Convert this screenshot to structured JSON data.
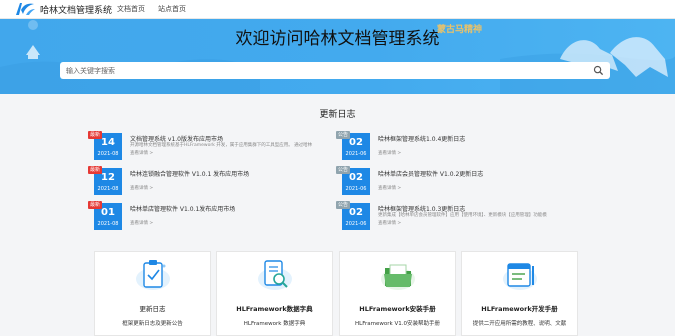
{
  "header": {
    "brand": "哈林文档管理系统",
    "nav": [
      "文档首页",
      "站点首页"
    ]
  },
  "hero": {
    "title": "欢迎访问哈林文档管理系统",
    "tagline": "蒙古马精神"
  },
  "search": {
    "placeholder": "输入关键字搜索"
  },
  "updates": {
    "title": "更新日志",
    "items": [
      {
        "badge": "最新",
        "badge_color": "red",
        "day": "14",
        "ym": "2021-08",
        "title": "文档管理系统 v1.0版发布应用市场",
        "desc": "开源哈林文档管理系统基于HLFramework 开发，属于应用集群下的工具型应用。  通过哈林",
        "more": "查看详情 >"
      },
      {
        "badge": "公告",
        "badge_color": "gray",
        "day": "02",
        "ym": "2021-06",
        "title": "哈林框架管理系统1.0.4更新日志",
        "desc": "",
        "more": "查看详情 >"
      },
      {
        "badge": "最新",
        "badge_color": "red",
        "day": "12",
        "ym": "2021-08",
        "title": "哈林连锁融合管理软件 V1.0.1 发布应用市场",
        "desc": "",
        "more": "查看详情 >"
      },
      {
        "badge": "公告",
        "badge_color": "gray",
        "day": "02",
        "ym": "2021-06",
        "title": "哈林单店会员管理软件 V1.0.2更新日志",
        "desc": "",
        "more": "查看详情 >"
      },
      {
        "badge": "最新",
        "badge_color": "red",
        "day": "01",
        "ym": "2021-08",
        "title": "哈林单店管理软件 V1.0.1发布应用市场",
        "desc": "",
        "more": "查看详情 >"
      },
      {
        "badge": "公告",
        "badge_color": "gray",
        "day": "02",
        "ym": "2021-06",
        "title": "哈林框架管理系统1.0.3更新日志",
        "desc": "更新集成【哈林单店会员管理软件】应用【使用环境】、更新模块【应用管理】功能模",
        "more": "查看详情 >"
      }
    ]
  },
  "cards": [
    {
      "title": "更新日志",
      "desc": "框架更新日志及更新公告",
      "icon": "clipboard-check-icon"
    },
    {
      "title": "HLFramework数据字典",
      "desc": "HLFramework 数据字典",
      "icon": "document-search-icon"
    },
    {
      "title": "HLFramework安装手册",
      "desc": "HLFramework V1.0安装帮助手册",
      "icon": "folder-icon"
    },
    {
      "title": "HLFramework开发手册",
      "desc": "提供二开应用所需的教程、说明、文献",
      "icon": "calendar-pen-icon"
    }
  ],
  "colors": {
    "primary": "#1e88e5",
    "hero": "#43aaee",
    "badge_new": "#e53935",
    "badge_notice": "#90a4ae"
  }
}
